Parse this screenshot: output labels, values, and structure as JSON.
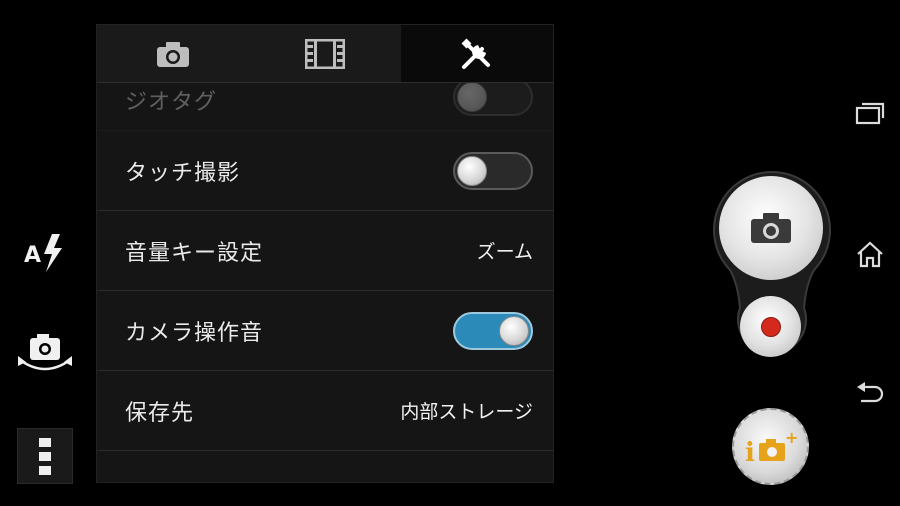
{
  "left_rail": {
    "flash_icon": "flash-auto-icon",
    "flash_letter": "A",
    "switch_camera_icon": "switch-camera-icon",
    "menu_icon": "more-vert-icon"
  },
  "tabs": [
    {
      "icon": "camera-icon",
      "active": false
    },
    {
      "icon": "film-icon",
      "active": false
    },
    {
      "icon": "tools-icon",
      "active": true
    }
  ],
  "settings": {
    "partial_row_label": "ジオタグ",
    "touch_capture": {
      "label": "タッチ撮影",
      "state": "off"
    },
    "volume_key": {
      "label": "音量キー設定",
      "value": "ズーム"
    },
    "camera_sound": {
      "label": "カメラ操作音",
      "state": "on"
    },
    "storage": {
      "label": "保存先",
      "value": "内部ストレージ"
    }
  },
  "controls": {
    "photo_icon": "camera-icon",
    "video_icon": "record-icon",
    "apps_icon": "camera-apps-icon",
    "apps_label": "i",
    "apps_plus": "+"
  },
  "nav": {
    "recents_icon": "recents-icon",
    "home_icon": "home-icon",
    "back_icon": "back-icon"
  },
  "colors": {
    "toggle_on": "#2b8ab8",
    "record": "#d42a1e",
    "apps_accent": "#e6a21a"
  }
}
